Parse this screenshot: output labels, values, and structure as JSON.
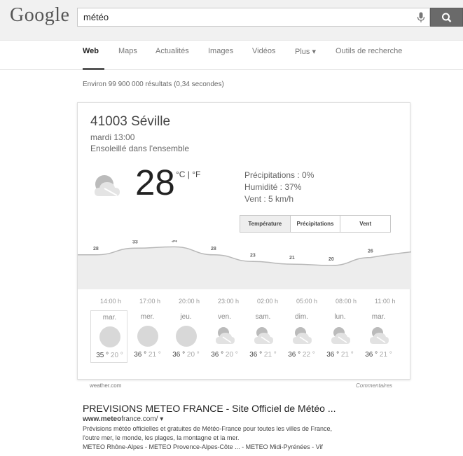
{
  "header": {
    "logo": "Google",
    "search_value": "météo"
  },
  "nav": {
    "tabs": [
      "Web",
      "Maps",
      "Actualités",
      "Images",
      "Vidéos",
      "Plus",
      "Outils de recherche"
    ],
    "active": "Web"
  },
  "stats": "Environ 99 900 000 résultats (0,34 secondes)",
  "weather": {
    "location": "41003 Séville",
    "datetime": "mardi 13:00",
    "condition": "Ensoleillé dans l'ensemble",
    "temperature": "28",
    "units": "°C | °F",
    "precip": "Précipitations : 0%",
    "humidity": "Humidité : 37%",
    "wind": "Vent : 5 km/h",
    "buttons": [
      "Température",
      "Précipitations",
      "Vent"
    ],
    "selected_button": "Température",
    "source": "weather.com",
    "feedback": "Commentaires"
  },
  "chart_data": {
    "type": "area",
    "x": [
      "14:00 h",
      "17:00 h",
      "20:00 h",
      "23:00 h",
      "02:00 h",
      "05:00 h",
      "08:00 h",
      "11:00 h"
    ],
    "values": [
      28,
      33,
      34,
      28,
      23,
      21,
      20,
      26
    ],
    "data_labels": [
      "28",
      "33",
      "34",
      "28",
      "23",
      "21",
      "20",
      "26"
    ]
  },
  "forecast": [
    {
      "day": "mar.",
      "icon": "sun-icon",
      "hi": "35 °",
      "lo": "20 °"
    },
    {
      "day": "mer.",
      "icon": "sun-icon",
      "hi": "36 °",
      "lo": "21 °"
    },
    {
      "day": "jeu.",
      "icon": "sun-icon",
      "hi": "36 °",
      "lo": "20 °"
    },
    {
      "day": "ven.",
      "icon": "partly-cloudy-icon",
      "hi": "36 °",
      "lo": "20 °"
    },
    {
      "day": "sam.",
      "icon": "partly-cloudy-icon",
      "hi": "36 °",
      "lo": "21 °"
    },
    {
      "day": "dim.",
      "icon": "partly-cloudy-icon",
      "hi": "36 °",
      "lo": "22 °"
    },
    {
      "day": "lun.",
      "icon": "partly-cloudy-icon",
      "hi": "36 °",
      "lo": "21 °"
    },
    {
      "day": "mar.",
      "icon": "partly-cloudy-icon",
      "hi": "36 °",
      "lo": "21 °"
    }
  ],
  "result": {
    "title": "PREVISIONS METEO FRANCE - Site Officiel de Météo ...",
    "url_bold": "www.meteo",
    "url_rest": "france.com/",
    "snippet_1": "Prévisions météo officielles et gratuites de Météo-France pour toutes les villes de France,",
    "snippet_2": "l'outre mer, le monde, les plages, la montagne et la mer.",
    "snippet_3": "METEO Rhône-Alpes - METEO Provence-Alpes-Côte ... - METEO Midi-Pyrénées - Vif"
  }
}
